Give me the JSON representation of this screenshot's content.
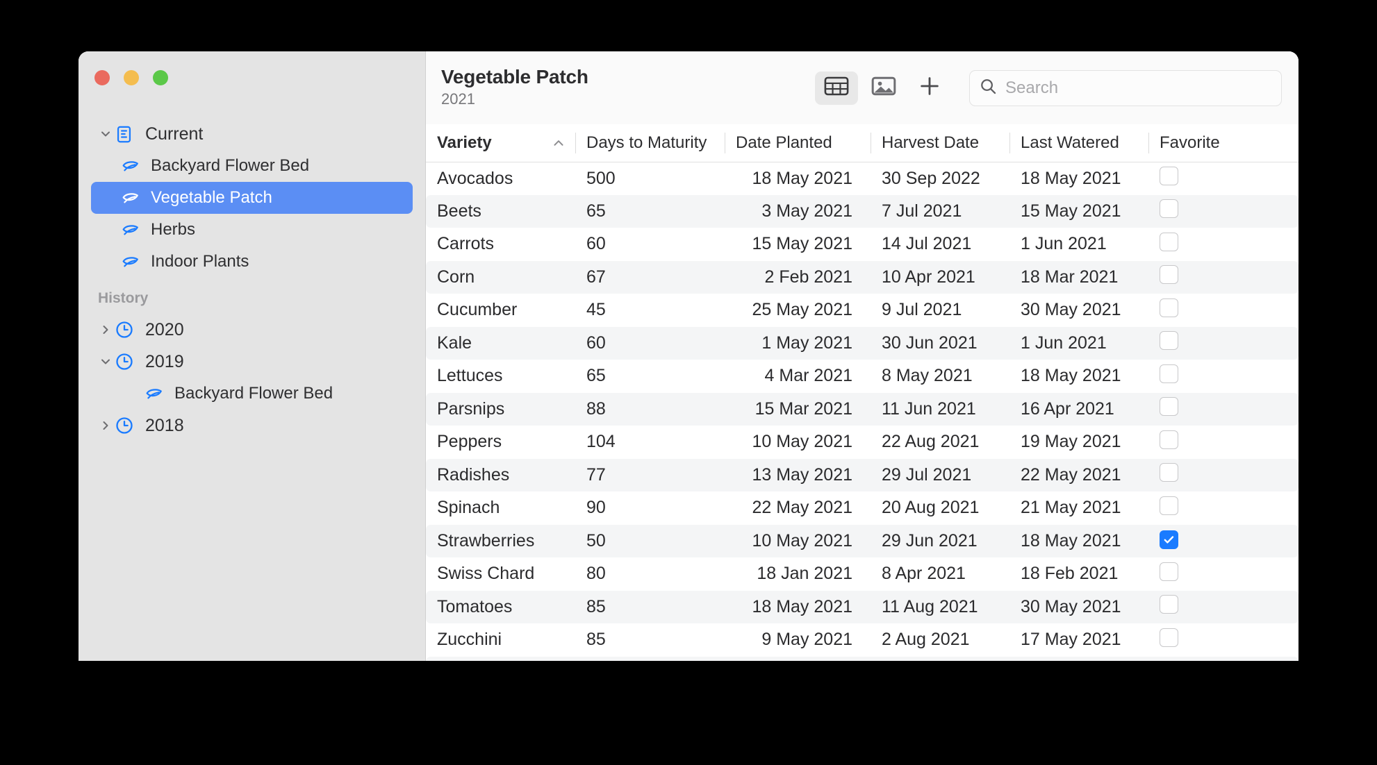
{
  "window": {
    "traffic_lights": [
      "close",
      "minimize",
      "zoom"
    ],
    "colors": {
      "close": "#ea6a5e",
      "minimize": "#f4bd4f",
      "zoom": "#5bc848",
      "accent": "#5b8ef4",
      "checkbox_checked": "#1a7bff",
      "leaf_icon": "#1a7bff"
    }
  },
  "sidebar": {
    "current": {
      "label": "Current",
      "icon": "document-icon",
      "expanded": true
    },
    "current_items": [
      {
        "label": "Backyard Flower Bed",
        "icon": "leaf-icon",
        "selected": false
      },
      {
        "label": "Vegetable Patch",
        "icon": "leaf-icon",
        "selected": true
      },
      {
        "label": "Herbs",
        "icon": "leaf-icon",
        "selected": false
      },
      {
        "label": "Indoor Plants",
        "icon": "leaf-icon",
        "selected": false
      }
    ],
    "history_header": "History",
    "history": [
      {
        "label": "2020",
        "icon": "clock-icon",
        "expanded": false,
        "children": []
      },
      {
        "label": "2019",
        "icon": "clock-icon",
        "expanded": true,
        "children": [
          {
            "label": "Backyard Flower Bed",
            "icon": "leaf-icon"
          }
        ]
      },
      {
        "label": "2018",
        "icon": "clock-icon",
        "expanded": false,
        "children": []
      }
    ]
  },
  "toolbar": {
    "title": "Vegetable Patch",
    "subtitle": "2021",
    "view_table_icon": "table-view-icon",
    "view_gallery_icon": "gallery-view-icon",
    "add_icon": "plus-icon",
    "active_view": "table",
    "search": {
      "icon": "search-icon",
      "placeholder": "Search",
      "value": ""
    }
  },
  "table": {
    "columns": [
      {
        "label": "Variety",
        "sorted": true,
        "sort_direction": "ascending",
        "align": "left"
      },
      {
        "label": "Days to Maturity",
        "sorted": false,
        "align": "left"
      },
      {
        "label": "Date Planted",
        "sorted": false,
        "align": "right"
      },
      {
        "label": "Harvest Date",
        "sorted": false,
        "align": "left"
      },
      {
        "label": "Last Watered",
        "sorted": false,
        "align": "left"
      },
      {
        "label": "Favorite",
        "sorted": false,
        "align": "left"
      }
    ],
    "rows": [
      {
        "variety": "Avocados",
        "days": "500",
        "planted": "18 May 2021",
        "harvest": "30 Sep 2022",
        "watered": "18 May 2021",
        "favorite": false
      },
      {
        "variety": "Beets",
        "days": "65",
        "planted": "3 May 2021",
        "harvest": "7 Jul 2021",
        "watered": "15 May 2021",
        "favorite": false
      },
      {
        "variety": "Carrots",
        "days": "60",
        "planted": "15 May 2021",
        "harvest": "14 Jul 2021",
        "watered": "1 Jun 2021",
        "favorite": false
      },
      {
        "variety": "Corn",
        "days": "67",
        "planted": "2 Feb 2021",
        "harvest": "10 Apr 2021",
        "watered": "18 Mar 2021",
        "favorite": false
      },
      {
        "variety": "Cucumber",
        "days": "45",
        "planted": "25 May 2021",
        "harvest": "9 Jul 2021",
        "watered": "30 May 2021",
        "favorite": false
      },
      {
        "variety": "Kale",
        "days": "60",
        "planted": "1 May 2021",
        "harvest": "30 Jun 2021",
        "watered": "1 Jun 2021",
        "favorite": false
      },
      {
        "variety": "Lettuces",
        "days": "65",
        "planted": "4 Mar 2021",
        "harvest": "8 May 2021",
        "watered": "18 May 2021",
        "favorite": false
      },
      {
        "variety": "Parsnips",
        "days": "88",
        "planted": "15 Mar 2021",
        "harvest": "11 Jun 2021",
        "watered": "16 Apr 2021",
        "favorite": false
      },
      {
        "variety": "Peppers",
        "days": "104",
        "planted": "10 May 2021",
        "harvest": "22 Aug 2021",
        "watered": "19 May 2021",
        "favorite": false
      },
      {
        "variety": "Radishes",
        "days": "77",
        "planted": "13 May 2021",
        "harvest": "29 Jul 2021",
        "watered": "22 May 2021",
        "favorite": false
      },
      {
        "variety": "Spinach",
        "days": "90",
        "planted": "22 May 2021",
        "harvest": "20 Aug 2021",
        "watered": "21 May 2021",
        "favorite": false
      },
      {
        "variety": "Strawberries",
        "days": "50",
        "planted": "10 May 2021",
        "harvest": "29 Jun 2021",
        "watered": "18 May 2021",
        "favorite": true
      },
      {
        "variety": "Swiss Chard",
        "days": "80",
        "planted": "18 Jan 2021",
        "harvest": "8 Apr 2021",
        "watered": "18 Feb 2021",
        "favorite": false
      },
      {
        "variety": "Tomatoes",
        "days": "85",
        "planted": "18 May 2021",
        "harvest": "11 Aug 2021",
        "watered": "30 May 2021",
        "favorite": false
      },
      {
        "variety": "Zucchini",
        "days": "85",
        "planted": "9 May 2021",
        "harvest": "2 Aug 2021",
        "watered": "17 May 2021",
        "favorite": false
      }
    ]
  }
}
